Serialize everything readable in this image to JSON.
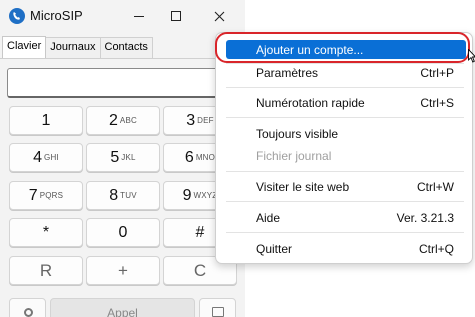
{
  "window": {
    "title": "MicroSIP",
    "minimize_glyph": "—",
    "maximize_glyph": "☐",
    "close_glyph": "✕"
  },
  "tabs": [
    {
      "label": "Clavier",
      "active": true
    },
    {
      "label": "Journaux",
      "active": false
    },
    {
      "label": "Contacts",
      "active": false
    }
  ],
  "dialpad": {
    "number_value": "",
    "keys": [
      {
        "digit": "1",
        "letters": ""
      },
      {
        "digit": "2",
        "letters": "ABC"
      },
      {
        "digit": "3",
        "letters": "DEF"
      },
      {
        "digit": "4",
        "letters": "GHI"
      },
      {
        "digit": "5",
        "letters": "JKL"
      },
      {
        "digit": "6",
        "letters": "MNO"
      },
      {
        "digit": "7",
        "letters": "PQRS"
      },
      {
        "digit": "8",
        "letters": "TUV"
      },
      {
        "digit": "9",
        "letters": "WXYZ"
      },
      {
        "digit": "*",
        "letters": ""
      },
      {
        "digit": "0",
        "letters": ""
      },
      {
        "digit": "#",
        "letters": ""
      }
    ],
    "actions": {
      "redial": "R",
      "plus": "+",
      "clear": "C"
    },
    "call_label": "Appel"
  },
  "menu": {
    "items": [
      {
        "label": "Ajouter un compte...",
        "shortcut": "",
        "highlighted": true,
        "disabled": false
      },
      {
        "label": "Paramètres",
        "shortcut": "Ctrl+P",
        "highlighted": false,
        "disabled": false
      },
      {
        "label": "Numérotation rapide",
        "shortcut": "Ctrl+S",
        "highlighted": false,
        "disabled": false
      },
      {
        "label": "Toujours visible",
        "shortcut": "",
        "highlighted": false,
        "disabled": false
      },
      {
        "label": "Fichier journal",
        "shortcut": "",
        "highlighted": false,
        "disabled": true
      },
      {
        "label": "Visiter le site web",
        "shortcut": "Ctrl+W",
        "highlighted": false,
        "disabled": false
      },
      {
        "label": "Aide",
        "shortcut": "Ver. 3.21.3",
        "highlighted": false,
        "disabled": false
      },
      {
        "label": "Quitter",
        "shortcut": "Ctrl+Q",
        "highlighted": false,
        "disabled": false
      }
    ]
  },
  "colors": {
    "accent": "#0a6fd6",
    "annotation": "#d9252a"
  }
}
